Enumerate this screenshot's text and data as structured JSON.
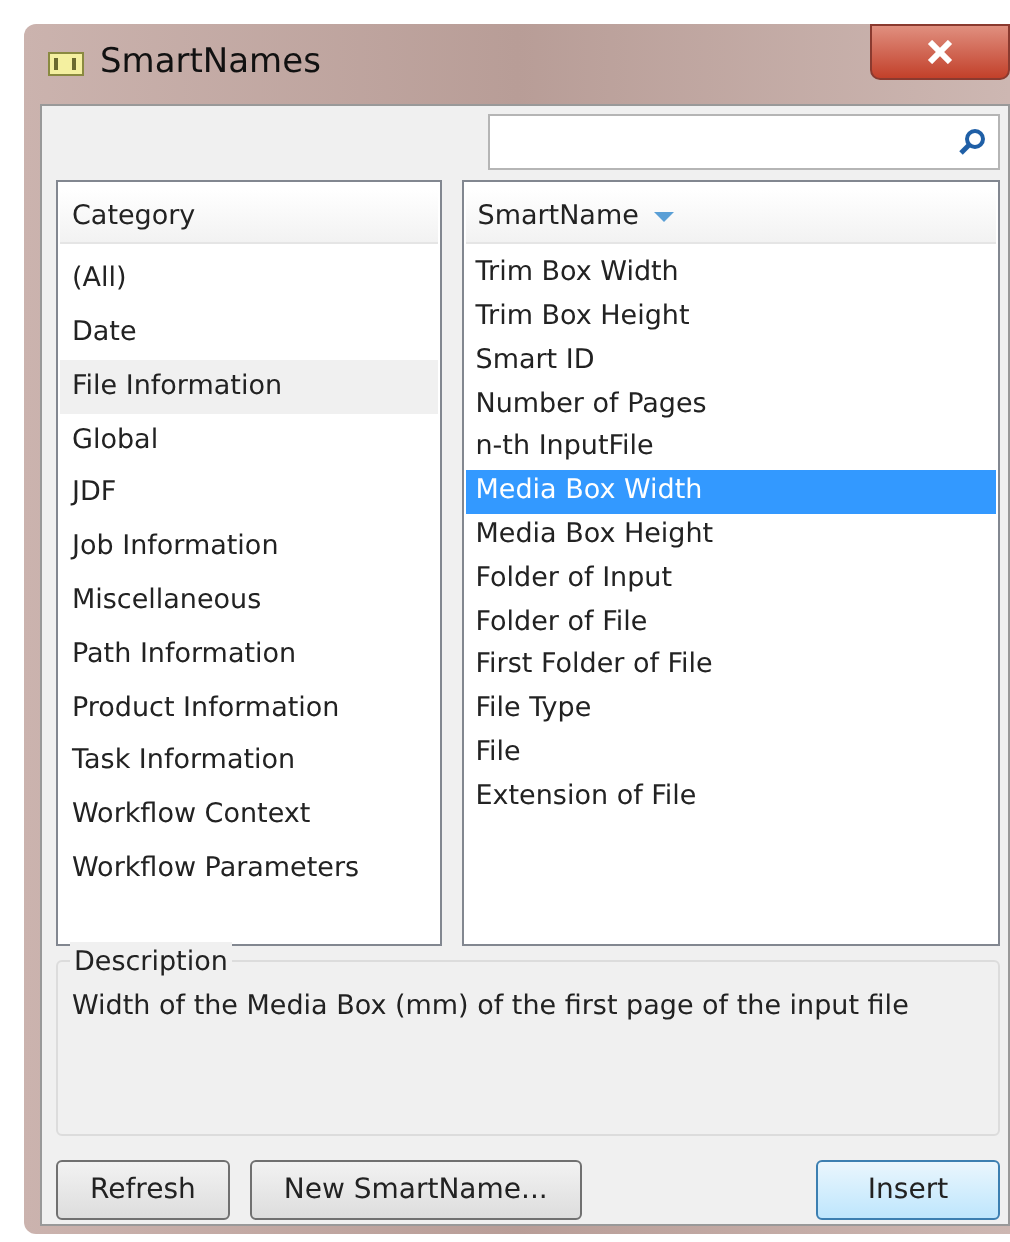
{
  "window": {
    "title": "SmartNames"
  },
  "category_list": {
    "header": "Category",
    "items": [
      {
        "label": "(All)",
        "selected": false
      },
      {
        "label": "Date",
        "selected": false
      },
      {
        "label": "File Information",
        "selected": true
      },
      {
        "label": "Global",
        "selected": false
      },
      {
        "label": "JDF",
        "selected": false
      },
      {
        "label": "Job Information",
        "selected": false
      },
      {
        "label": "Miscellaneous",
        "selected": false
      },
      {
        "label": "Path Information",
        "selected": false
      },
      {
        "label": "Product Information",
        "selected": false
      },
      {
        "label": "Task Information",
        "selected": false
      },
      {
        "label": "Workflow Context",
        "selected": false
      },
      {
        "label": "Workflow Parameters",
        "selected": false
      }
    ]
  },
  "smartname_list": {
    "header": "SmartName",
    "items": [
      {
        "label": "Trim Box Width",
        "selected": false
      },
      {
        "label": "Trim Box Height",
        "selected": false
      },
      {
        "label": "Smart ID",
        "selected": false
      },
      {
        "label": "Number of Pages",
        "selected": false
      },
      {
        "label": "n-th InputFile",
        "selected": false
      },
      {
        "label": "Media Box Width",
        "selected": true
      },
      {
        "label": "Media Box Height",
        "selected": false
      },
      {
        "label": "Folder of Input",
        "selected": false
      },
      {
        "label": "Folder of File",
        "selected": false
      },
      {
        "label": "First Folder of File",
        "selected": false
      },
      {
        "label": "File Type",
        "selected": false
      },
      {
        "label": "File",
        "selected": false
      },
      {
        "label": "Extension of File",
        "selected": false
      }
    ]
  },
  "description": {
    "label": "Description",
    "text": "Width of the Media Box (mm) of the first page of the input file"
  },
  "buttons": [
    {
      "label": "Refresh",
      "kind": "normal"
    },
    {
      "label": "New SmartName...",
      "kind": "normal"
    },
    {
      "label": "Insert",
      "kind": "default"
    }
  ]
}
